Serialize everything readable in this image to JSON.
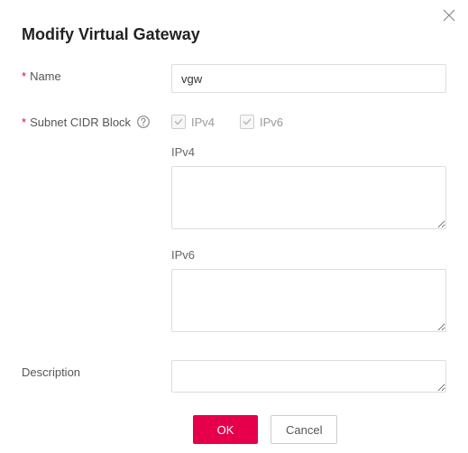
{
  "dialog": {
    "title": "Modify Virtual Gateway"
  },
  "form": {
    "name_label": "Name",
    "name_value": "vgw",
    "subnet_label": "Subnet CIDR Block",
    "ipv4_option": "IPv4",
    "ipv6_option": "IPv6",
    "ipv4_checked": true,
    "ipv6_checked": true,
    "ipv4_section_label": "IPv4",
    "ipv4_value": "",
    "ipv6_section_label": "IPv6",
    "ipv6_value": "",
    "description_label": "Description",
    "description_value": ""
  },
  "actions": {
    "ok": "OK",
    "cancel": "Cancel"
  }
}
